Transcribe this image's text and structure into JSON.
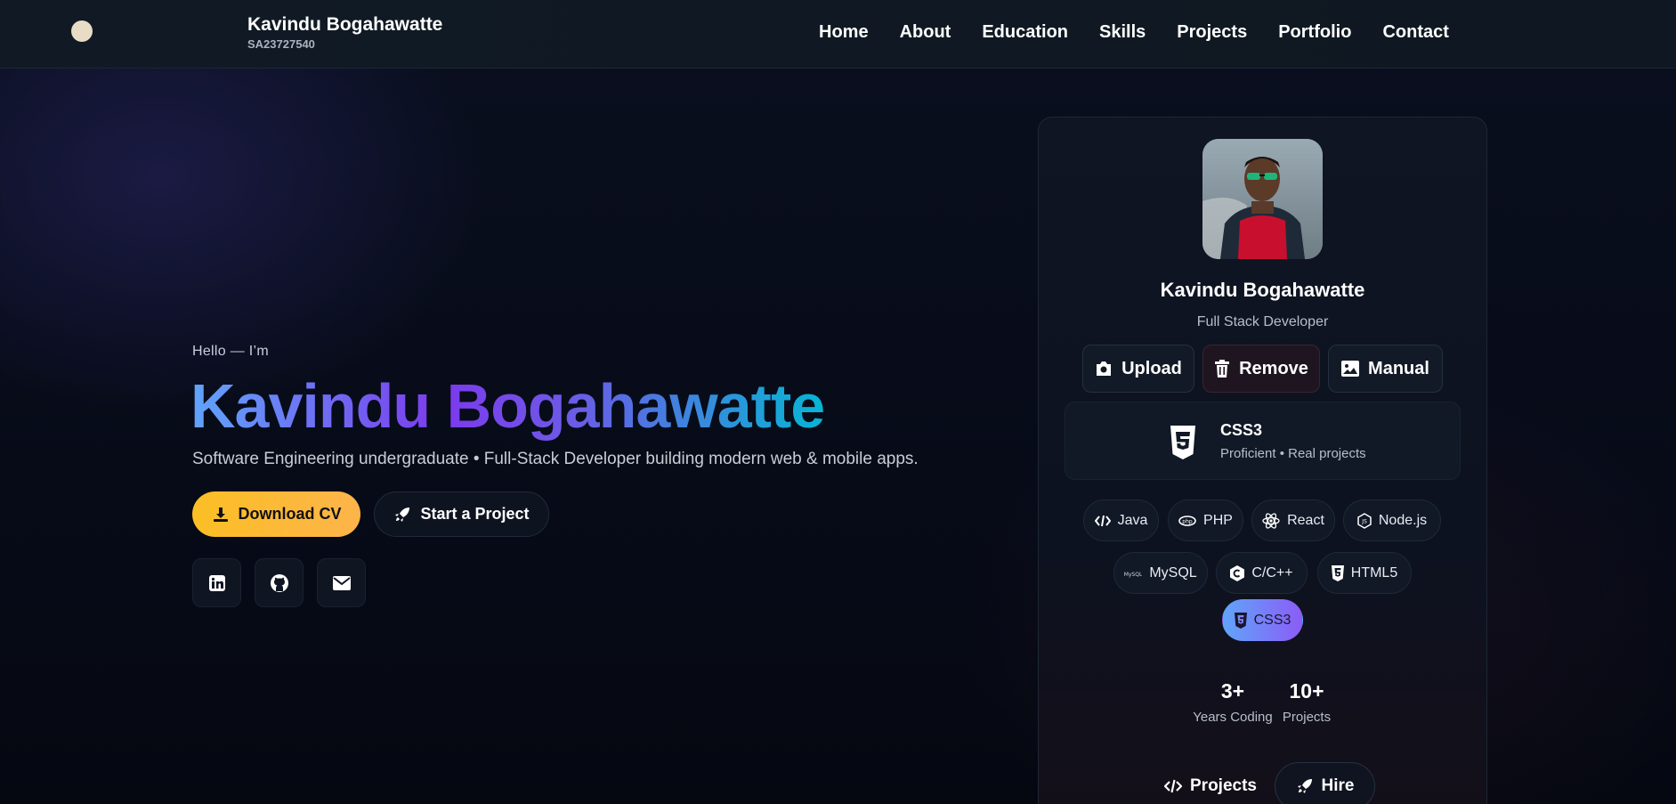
{
  "nav": {
    "brand_name": "Kavindu Bogahawatte",
    "brand_id": "SA23727540",
    "links": [
      "Home",
      "About",
      "Education",
      "Skills",
      "Projects",
      "Portfolio",
      "Contact"
    ]
  },
  "hero": {
    "greeting": "Hello — I’m",
    "name": "Kavindu Bogahawatte",
    "subtitle": "Software Engineering undergraduate • Full-Stack Developer building modern web & mobile apps.",
    "download_cv": "Download CV",
    "start_project": "Start a Project",
    "social_icons": [
      "linkedin-icon",
      "github-icon",
      "mail-icon"
    ],
    "accent_color": "#fbbf24"
  },
  "card": {
    "name": "Kavindu Bogahawatte",
    "role": "Full Stack Developer",
    "buttons": {
      "upload": "Upload",
      "remove": "Remove",
      "manual": "Manual"
    },
    "selected_skill": {
      "title": "CSS3",
      "subtitle": "Proficient • Real projects"
    },
    "skills": [
      "Java",
      "PHP",
      "React",
      "Node.js",
      "MySQL",
      "C/C++",
      "HTML5",
      "CSS3"
    ],
    "active_skill": "CSS3",
    "stats": [
      {
        "value": "3+",
        "label": "Years Coding"
      },
      {
        "value": "10+",
        "label": "Projects"
      }
    ],
    "bottom_buttons": {
      "projects": "Projects",
      "hire": "Hire"
    }
  }
}
